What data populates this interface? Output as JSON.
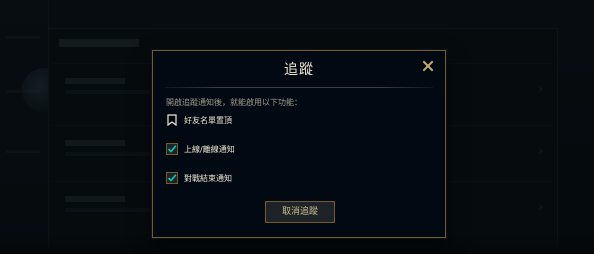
{
  "modal": {
    "title": "追蹤",
    "close_icon": "close-icon",
    "description": "開啟追蹤通知後，就能啟用以下功能：",
    "options": [
      {
        "label": "好友名單置頂",
        "icon": "ribbon-icon",
        "checkbox": false
      },
      {
        "label": "上線/離線通知",
        "icon": "checkbox",
        "checked": true
      },
      {
        "label": "對戰結束通知",
        "icon": "checkbox",
        "checked": true
      }
    ],
    "cancel_button": "取消追蹤"
  },
  "colors": {
    "gold_border": "#785a28",
    "gold_text": "#c8aa6e",
    "title_text": "#f0e6d2",
    "desc_text": "#a09b8c",
    "check_blue": "#0ac8b9",
    "modal_bg": "#010a13"
  }
}
